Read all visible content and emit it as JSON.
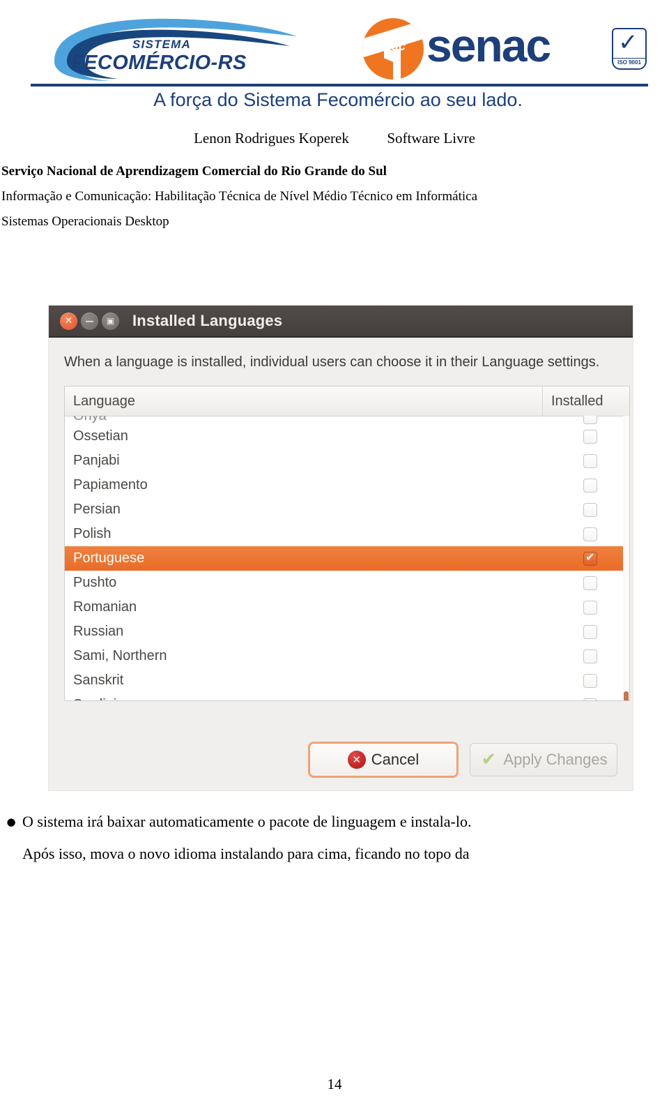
{
  "letterhead": {
    "fecomercio_line1": "SISTEMA",
    "fecomercio_line2": "FECOMÉRCIO-RS",
    "senac_mark_word": "senac",
    "senac_wordmark": "senac",
    "iso_label": "ISO 9001",
    "tagline": "A força do Sistema Fecomércio ao seu lado.",
    "brand_blue": "#1d3f7a",
    "brand_orange": "#ef7521"
  },
  "doc": {
    "author": "Lenon Rodrigues Koperek",
    "subject": "Software Livre",
    "institution": "Serviço Nacional de Aprendizagem Comercial do Rio Grande do Sul",
    "course": "Informação e Comunicação: Habilitação Técnica de Nível Médio Técnico em Informática",
    "discipline": "Sistemas Operacionais Desktop",
    "page_number": "14"
  },
  "dialog": {
    "title": "Installed Languages",
    "window_buttons": [
      {
        "name": "close",
        "glyph": "✕"
      },
      {
        "name": "minimize",
        "glyph": "—"
      },
      {
        "name": "maximize",
        "glyph": "▣"
      }
    ],
    "description": "When a language is installed, individual users can choose it in their Language settings.",
    "columns": {
      "language": "Language",
      "installed": "Installed"
    },
    "rows": [
      {
        "name": "Oriya",
        "installed": false,
        "selected": false,
        "partial": true
      },
      {
        "name": "Ossetian",
        "installed": false,
        "selected": false
      },
      {
        "name": "Panjabi",
        "installed": false,
        "selected": false
      },
      {
        "name": "Papiamento",
        "installed": false,
        "selected": false
      },
      {
        "name": "Persian",
        "installed": false,
        "selected": false
      },
      {
        "name": "Polish",
        "installed": false,
        "selected": false
      },
      {
        "name": "Portuguese",
        "installed": true,
        "selected": true
      },
      {
        "name": "Pushto",
        "installed": false,
        "selected": false
      },
      {
        "name": "Romanian",
        "installed": false,
        "selected": false
      },
      {
        "name": "Russian",
        "installed": false,
        "selected": false
      },
      {
        "name": "Sami, Northern",
        "installed": false,
        "selected": false
      },
      {
        "name": "Sanskrit",
        "installed": false,
        "selected": false
      },
      {
        "name": "Sardinian",
        "installed": false,
        "selected": false
      }
    ],
    "buttons": {
      "cancel": "Cancel",
      "apply": "Apply Changes",
      "apply_enabled": false
    },
    "colors": {
      "titlebar": "#4a4543",
      "selection": "#ee7030",
      "scrollbar_thumb": "#c3764f",
      "dialog_bg": "#f0efed"
    }
  },
  "bullets": [
    "O sistema irá baixar automaticamente o pacote de linguagem e instala-lo.",
    "Após isso, mova o novo idioma instalando para cima, ficando no topo da"
  ],
  "bullet_marker": "●"
}
